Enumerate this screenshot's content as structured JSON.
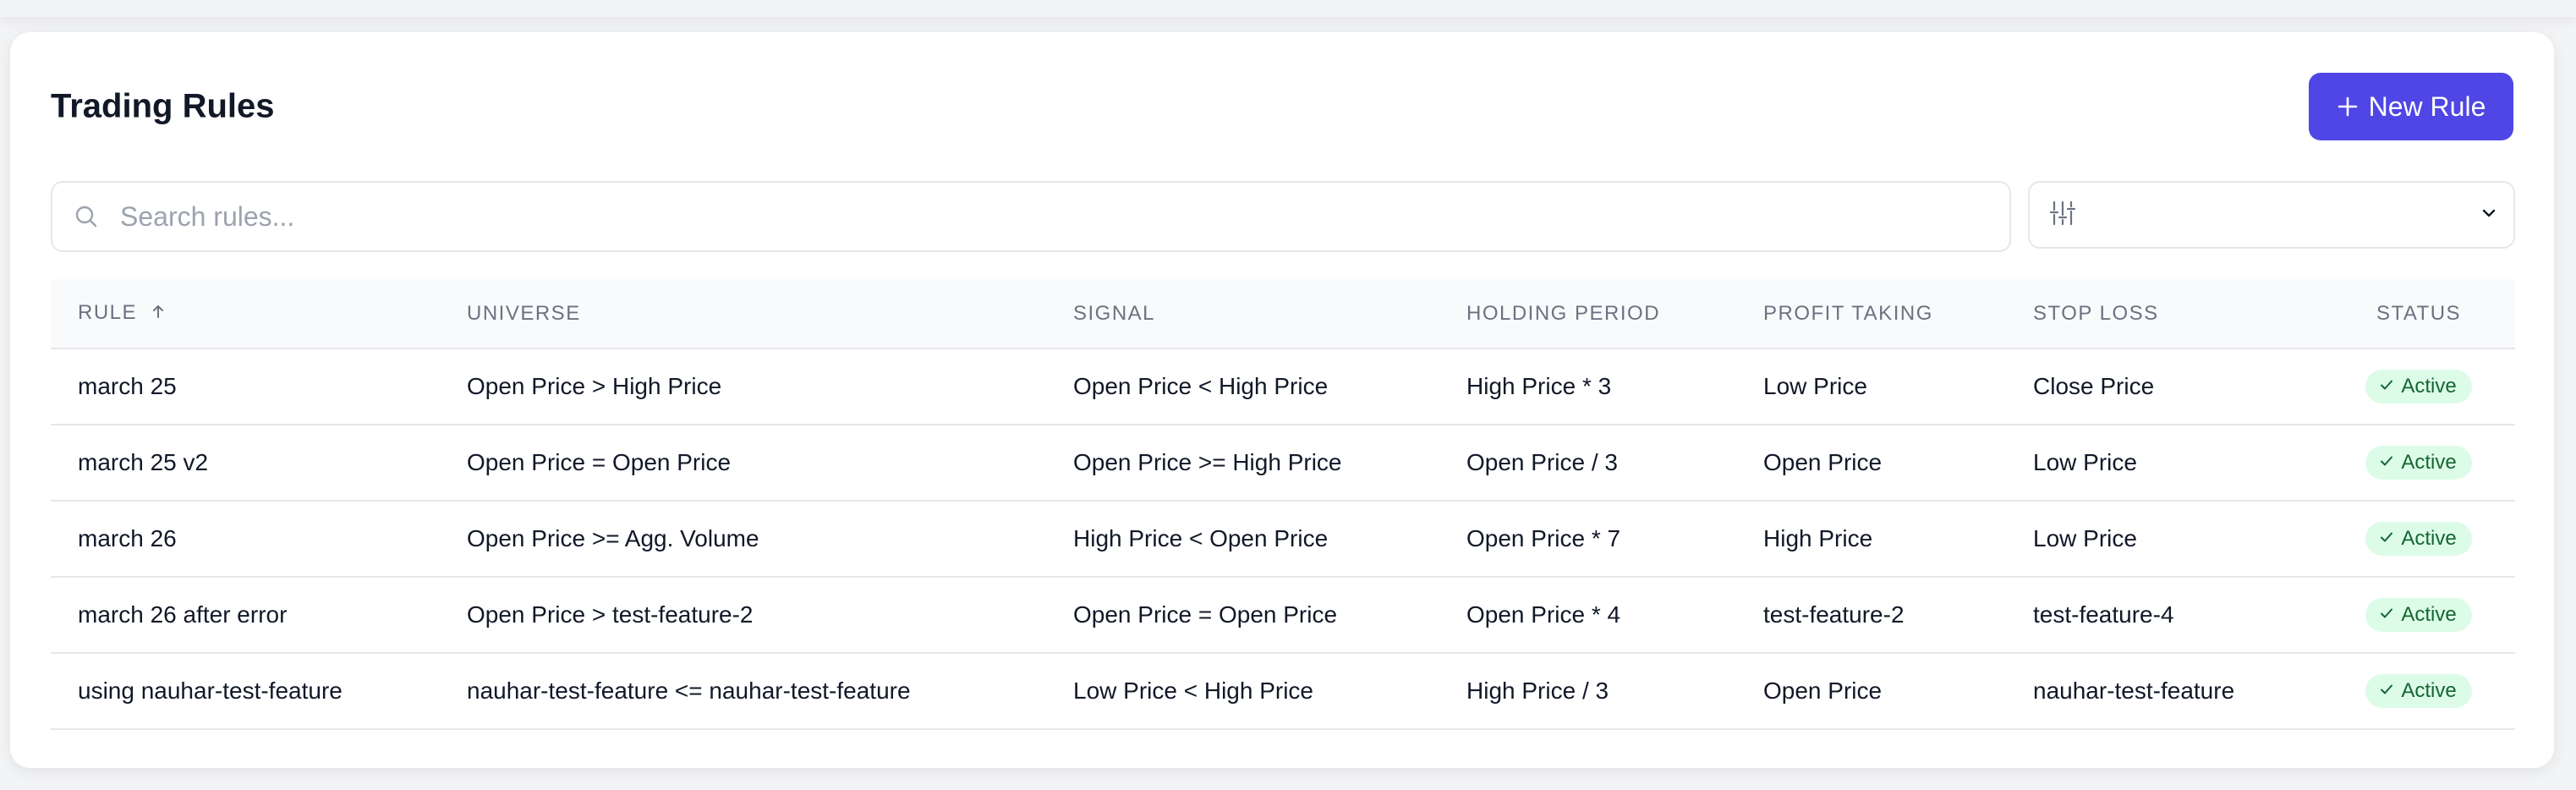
{
  "page": {
    "title": "Trading Rules",
    "new_rule_label": "New Rule"
  },
  "search": {
    "placeholder": "Search rules...",
    "value": ""
  },
  "filter": {
    "selected": ""
  },
  "table": {
    "columns": {
      "rule": "RULE",
      "universe": "UNIVERSE",
      "signal": "SIGNAL",
      "holding_period": "HOLDING PERIOD",
      "profit_taking": "PROFIT TAKING",
      "stop_loss": "STOP LOSS",
      "status": "STATUS"
    },
    "sort": {
      "column": "rule",
      "direction": "ascending"
    },
    "rows": [
      {
        "rule": "march 25",
        "universe": "Open Price > High Price",
        "signal": "Open Price < High Price",
        "holding_period": "High Price * 3",
        "profit_taking": "Low Price",
        "stop_loss": "Close Price",
        "status": "Active"
      },
      {
        "rule": "march 25 v2",
        "universe": "Open Price = Open Price",
        "signal": "Open Price >= High Price",
        "holding_period": "Open Price / 3",
        "profit_taking": "Open Price",
        "stop_loss": "Low Price",
        "status": "Active"
      },
      {
        "rule": "march 26",
        "universe": "Open Price >= Agg. Volume",
        "signal": "High Price < Open Price",
        "holding_period": "Open Price * 7",
        "profit_taking": "High Price",
        "stop_loss": "Low Price",
        "status": "Active"
      },
      {
        "rule": "march 26 after error",
        "universe": "Open Price > test-feature-2",
        "signal": "Open Price = Open Price",
        "holding_period": "Open Price * 4",
        "profit_taking": "test-feature-2",
        "stop_loss": "test-feature-4",
        "status": "Active"
      },
      {
        "rule": "using nauhar-test-feature",
        "universe": "nauhar-test-feature <= nauhar-test-feature",
        "signal": "Low Price < High Price",
        "holding_period": "High Price / 3",
        "profit_taking": "Open Price",
        "stop_loss": "nauhar-test-feature",
        "status": "Active"
      }
    ]
  },
  "colors": {
    "accent": "#4f46e5",
    "status_active_bg": "#dcfce7",
    "status_active_text": "#166534"
  },
  "icons": {
    "new_rule": "plus-icon",
    "search": "search-icon",
    "filter": "sliders-icon",
    "dropdown": "chevron-down-icon",
    "sort": "arrow-up-icon",
    "status": "check-icon"
  }
}
